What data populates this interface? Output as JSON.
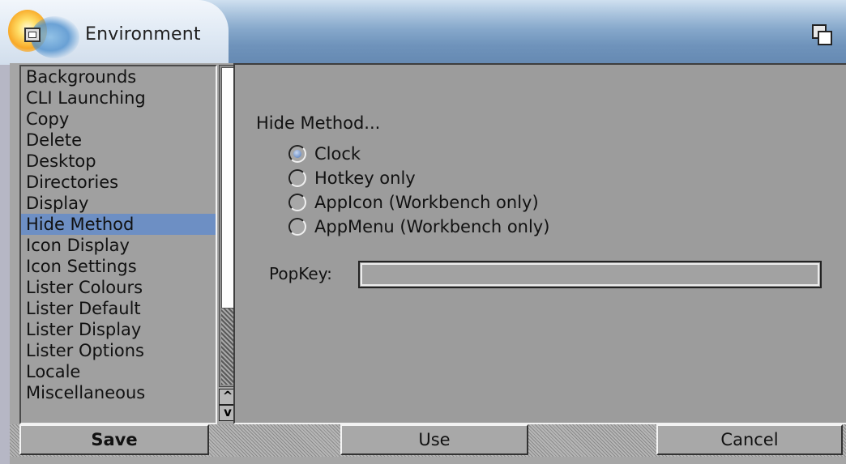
{
  "window": {
    "title": "Environment"
  },
  "list": {
    "items": [
      {
        "label": "Backgrounds",
        "selected": false
      },
      {
        "label": "CLI Launching",
        "selected": false
      },
      {
        "label": "Copy",
        "selected": false
      },
      {
        "label": "Delete",
        "selected": false
      },
      {
        "label": "Desktop",
        "selected": false
      },
      {
        "label": "Directories",
        "selected": false
      },
      {
        "label": "Display",
        "selected": false
      },
      {
        "label": "Hide Method",
        "selected": true
      },
      {
        "label": "Icon Display",
        "selected": false
      },
      {
        "label": "Icon Settings",
        "selected": false
      },
      {
        "label": "Lister Colours",
        "selected": false
      },
      {
        "label": "Lister Default",
        "selected": false
      },
      {
        "label": "Lister Display",
        "selected": false
      },
      {
        "label": "Lister Options",
        "selected": false
      },
      {
        "label": "Locale",
        "selected": false
      },
      {
        "label": "Miscellaneous",
        "selected": false
      }
    ],
    "scroll_up_glyph": "^",
    "scroll_down_glyph": "v"
  },
  "panel": {
    "section_label": "Hide Method...",
    "options": [
      {
        "label": "Clock",
        "checked": true
      },
      {
        "label": "Hotkey only",
        "checked": false
      },
      {
        "label": "AppIcon (Workbench only)",
        "checked": false
      },
      {
        "label": "AppMenu (Workbench only)",
        "checked": false
      }
    ],
    "popkey_label": "PopKey:",
    "popkey_value": ""
  },
  "buttons": {
    "save": "Save",
    "use": "Use",
    "cancel": "Cancel"
  },
  "colors": {
    "selection": "#6d8fc4",
    "panel_bg": "#9c9c9c",
    "title_gradient_end": "#6589b2"
  }
}
